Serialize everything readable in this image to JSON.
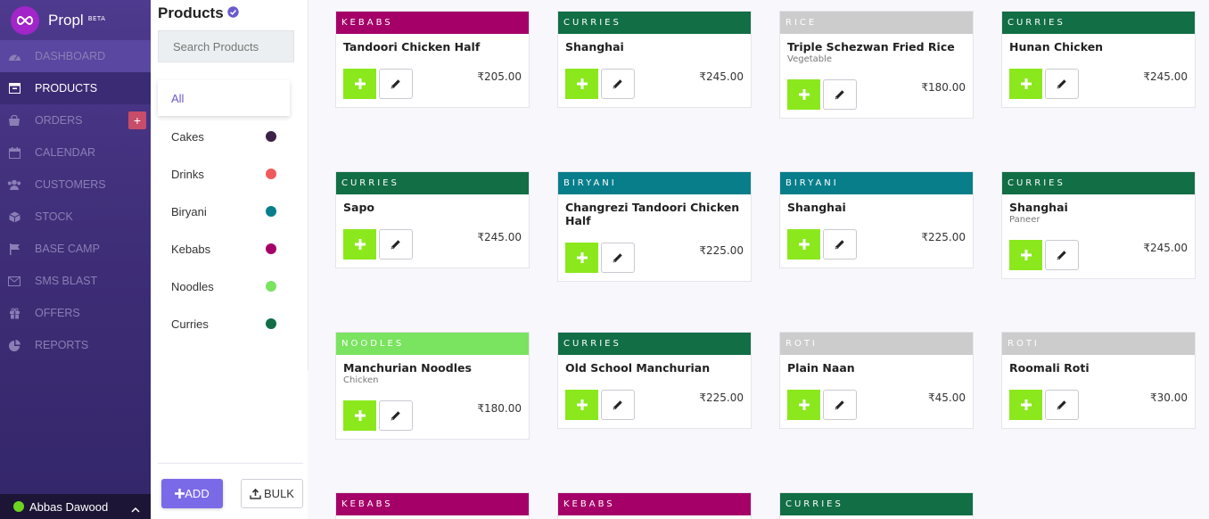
{
  "brand": {
    "name": "Propl",
    "badge": "BETA"
  },
  "nav": [
    {
      "label": "DASHBOARD",
      "icon": "dashboard-icon",
      "state": "hovered"
    },
    {
      "label": "PRODUCTS",
      "icon": "products-icon",
      "state": "active"
    },
    {
      "label": "ORDERS",
      "icon": "orders-icon",
      "state": "",
      "plus": "+"
    },
    {
      "label": "CALENDAR",
      "icon": "calendar-icon",
      "state": ""
    },
    {
      "label": "CUSTOMERS",
      "icon": "customers-icon",
      "state": ""
    },
    {
      "label": "STOCK",
      "icon": "stock-icon",
      "state": ""
    },
    {
      "label": "BASE CAMP",
      "icon": "flag-icon",
      "state": ""
    },
    {
      "label": "SMS BLAST",
      "icon": "envelope-icon",
      "state": ""
    },
    {
      "label": "OFFERS",
      "icon": "gift-icon",
      "state": ""
    },
    {
      "label": "REPORTS",
      "icon": "pie-chart-icon",
      "state": ""
    }
  ],
  "user": {
    "name": "Abbas Dawood",
    "status_color": "#6ed421"
  },
  "products_panel": {
    "title": "Products",
    "search_placeholder": "Search Products",
    "categories": [
      {
        "label": "All",
        "active": true,
        "color": ""
      },
      {
        "label": "Cakes",
        "color": "#3e2147"
      },
      {
        "label": "Drinks",
        "color": "#ef5b5b"
      },
      {
        "label": "Biryani",
        "color": "#087e8b"
      },
      {
        "label": "Kebabs",
        "color": "#a50068"
      },
      {
        "label": "Noodles",
        "color": "#7ae35f"
      },
      {
        "label": "Curries",
        "color": "#116e45"
      }
    ],
    "add_label": "ADD",
    "bulk_label": "BULK"
  },
  "tag_colors": {
    "KEBABS": "#a50068",
    "CURRIES": "#116e45",
    "RICE": "#cccccc",
    "BIRYANI": "#087e8b",
    "NOODLES": "#7ae35f",
    "ROTI": "#cccccc"
  },
  "products": [
    {
      "tag": "KEBABS",
      "name": "Tandoori Chicken Half",
      "sub": "",
      "price": "₹205.00"
    },
    {
      "tag": "CURRIES",
      "name": "Shanghai",
      "sub": "",
      "price": "₹245.00"
    },
    {
      "tag": "RICE",
      "name": "Triple Schezwan Fried Rice",
      "sub": "Vegetable",
      "price": "₹180.00"
    },
    {
      "tag": "CURRIES",
      "name": "Hunan Chicken",
      "sub": "",
      "price": "₹245.00"
    },
    {
      "tag": "CURRIES",
      "name": "Sapo",
      "sub": "",
      "price": "₹245.00"
    },
    {
      "tag": "BIRYANI",
      "name": "Changrezi Tandoori Chicken Half",
      "sub": "",
      "price": "₹225.00"
    },
    {
      "tag": "BIRYANI",
      "name": "Shanghai",
      "sub": "",
      "price": "₹225.00"
    },
    {
      "tag": "CURRIES",
      "name": "Shanghai",
      "sub": "Paneer",
      "price": "₹245.00"
    },
    {
      "tag": "NOODLES",
      "name": "Manchurian Noodles",
      "sub": "Chicken",
      "price": "₹180.00"
    },
    {
      "tag": "CURRIES",
      "name": "Old School Manchurian",
      "sub": "",
      "price": "₹225.00"
    },
    {
      "tag": "ROTI",
      "name": "Plain Naan",
      "sub": "",
      "price": "₹45.00"
    },
    {
      "tag": "ROTI",
      "name": "Roomali Roti",
      "sub": "",
      "price": "₹30.00"
    },
    {
      "tag": "KEBABS",
      "name": "",
      "sub": "",
      "price": ""
    },
    {
      "tag": "KEBABS",
      "name": "",
      "sub": "",
      "price": ""
    },
    {
      "tag": "CURRIES",
      "name": "",
      "sub": "",
      "price": ""
    }
  ]
}
